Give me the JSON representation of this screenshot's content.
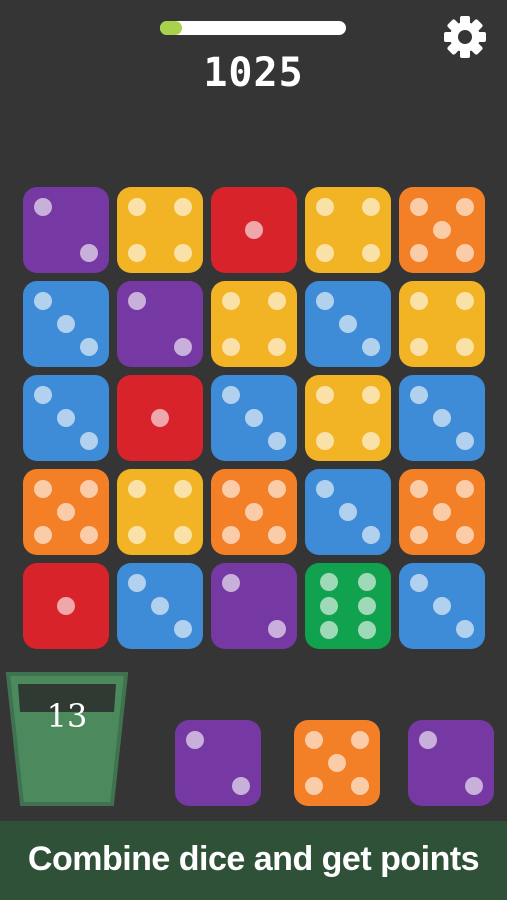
{
  "hud": {
    "progress": 0.12,
    "score": "1025"
  },
  "colors": {
    "purple": "#7639a3",
    "yellow": "#f2b324",
    "red": "#d8232b",
    "blue": "#3e8bd7",
    "orange": "#f37f26",
    "green": "#10a24e",
    "background": "#353535",
    "banner": "#2f5138",
    "progress_fill": "#a8d24e"
  },
  "board": {
    "rows": [
      [
        {
          "color": "purple",
          "pips": 2
        },
        {
          "color": "yellow",
          "pips": 4
        },
        {
          "color": "red",
          "pips": 1
        },
        {
          "color": "yellow",
          "pips": 4
        },
        {
          "color": "orange",
          "pips": 5
        }
      ],
      [
        {
          "color": "blue",
          "pips": 3
        },
        {
          "color": "purple",
          "pips": 2
        },
        {
          "color": "yellow",
          "pips": 4
        },
        {
          "color": "blue",
          "pips": 3
        },
        {
          "color": "yellow",
          "pips": 4
        }
      ],
      [
        {
          "color": "blue",
          "pips": 3
        },
        {
          "color": "red",
          "pips": 1
        },
        {
          "color": "blue",
          "pips": 3
        },
        {
          "color": "yellow",
          "pips": 4
        },
        {
          "color": "blue",
          "pips": 3
        }
      ],
      [
        {
          "color": "orange",
          "pips": 5
        },
        {
          "color": "yellow",
          "pips": 4
        },
        {
          "color": "orange",
          "pips": 5
        },
        {
          "color": "blue",
          "pips": 3
        },
        {
          "color": "orange",
          "pips": 5
        }
      ],
      [
        {
          "color": "red",
          "pips": 1
        },
        {
          "color": "blue",
          "pips": 3
        },
        {
          "color": "purple",
          "pips": 2
        },
        {
          "color": "green",
          "pips": 6
        },
        {
          "color": "blue",
          "pips": 3
        }
      ]
    ]
  },
  "queue": [
    {
      "color": "purple",
      "pips": 2
    },
    {
      "color": "orange",
      "pips": 5
    },
    {
      "color": "purple",
      "pips": 2
    }
  ],
  "cup": {
    "count": "13"
  },
  "banner": {
    "text": "Combine dice and get points"
  },
  "icons": {
    "settings": "gear-icon"
  }
}
